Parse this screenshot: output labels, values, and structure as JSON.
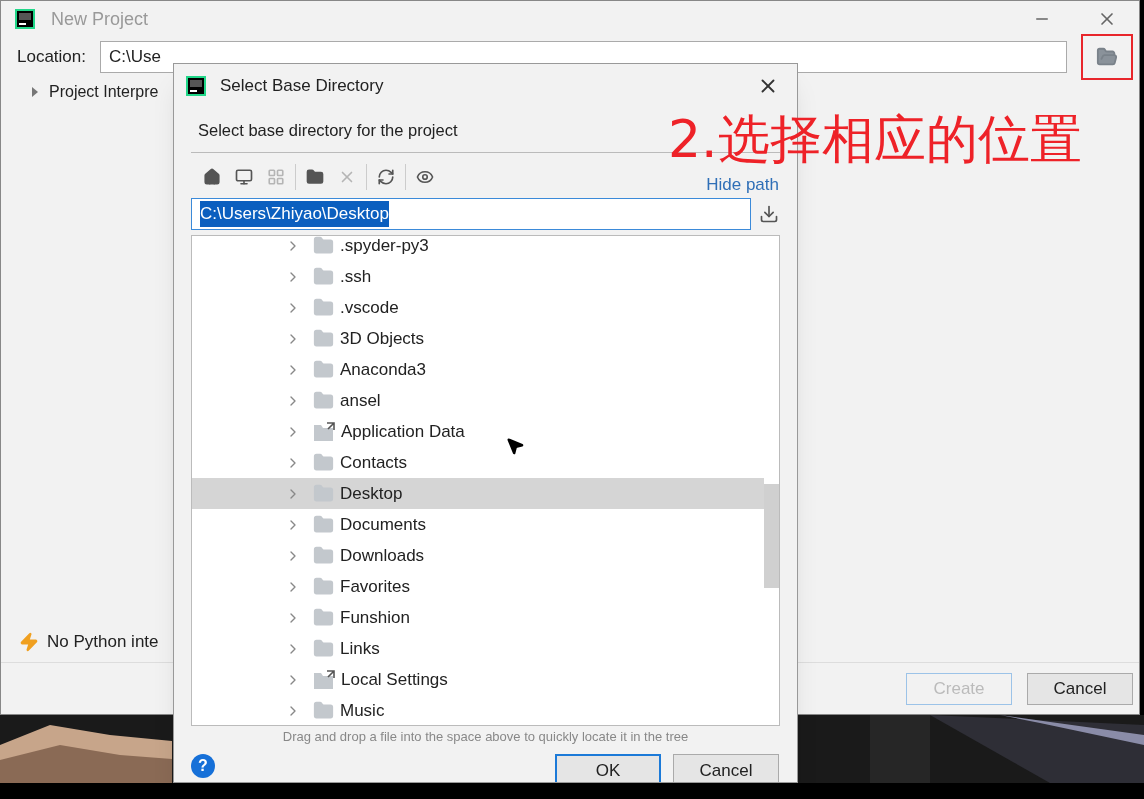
{
  "window": {
    "title": "New Project",
    "location_label": "Location:",
    "location_value": "C:\\Use",
    "interpreter_section": "Project Interpre",
    "warning": "No Python inte",
    "buttons": [
      {
        "label": "Create",
        "disabled": true
      },
      {
        "label": "Cancel",
        "disabled": false
      }
    ]
  },
  "annotation": {
    "text": "2.选择相应的位置"
  },
  "dialog": {
    "title": "Select Base Directory",
    "description": "Select base directory for the project",
    "toolbar": [
      {
        "kind": "home",
        "disabled": false
      },
      {
        "kind": "desktop",
        "disabled": false
      },
      {
        "kind": "module",
        "disabled": true
      },
      {
        "kind": "new-folder",
        "disabled": false
      },
      {
        "kind": "delete",
        "disabled": true
      },
      {
        "kind": "refresh",
        "disabled": false
      },
      {
        "kind": "hidden",
        "disabled": false
      }
    ],
    "hide_path": "Hide path",
    "path": "C:\\Users\\Zhiyao\\Desktop",
    "tree": [
      {
        "name": ".spyder-py3",
        "kind": "folder",
        "selected": false
      },
      {
        "name": ".ssh",
        "kind": "folder",
        "selected": false
      },
      {
        "name": ".vscode",
        "kind": "folder",
        "selected": false
      },
      {
        "name": "3D Objects",
        "kind": "folder",
        "selected": false
      },
      {
        "name": "Anaconda3",
        "kind": "folder",
        "selected": false
      },
      {
        "name": "ansel",
        "kind": "folder",
        "selected": false
      },
      {
        "name": "Application Data",
        "kind": "link",
        "selected": false
      },
      {
        "name": "Contacts",
        "kind": "folder",
        "selected": false
      },
      {
        "name": "Desktop",
        "kind": "folder",
        "selected": true
      },
      {
        "name": "Documents",
        "kind": "folder",
        "selected": false
      },
      {
        "name": "Downloads",
        "kind": "folder",
        "selected": false
      },
      {
        "name": "Favorites",
        "kind": "folder",
        "selected": false
      },
      {
        "name": "Funshion",
        "kind": "folder",
        "selected": false
      },
      {
        "name": "Links",
        "kind": "folder",
        "selected": false
      },
      {
        "name": "Local Settings",
        "kind": "link",
        "selected": false
      },
      {
        "name": "Music",
        "kind": "folder",
        "selected": false
      }
    ],
    "hint": "Drag and drop a file into the space above to quickly locate it in the tree",
    "help": "?",
    "buttons": [
      {
        "label": "OK",
        "kind": "default"
      },
      {
        "label": "Cancel",
        "kind": "normal"
      }
    ]
  }
}
